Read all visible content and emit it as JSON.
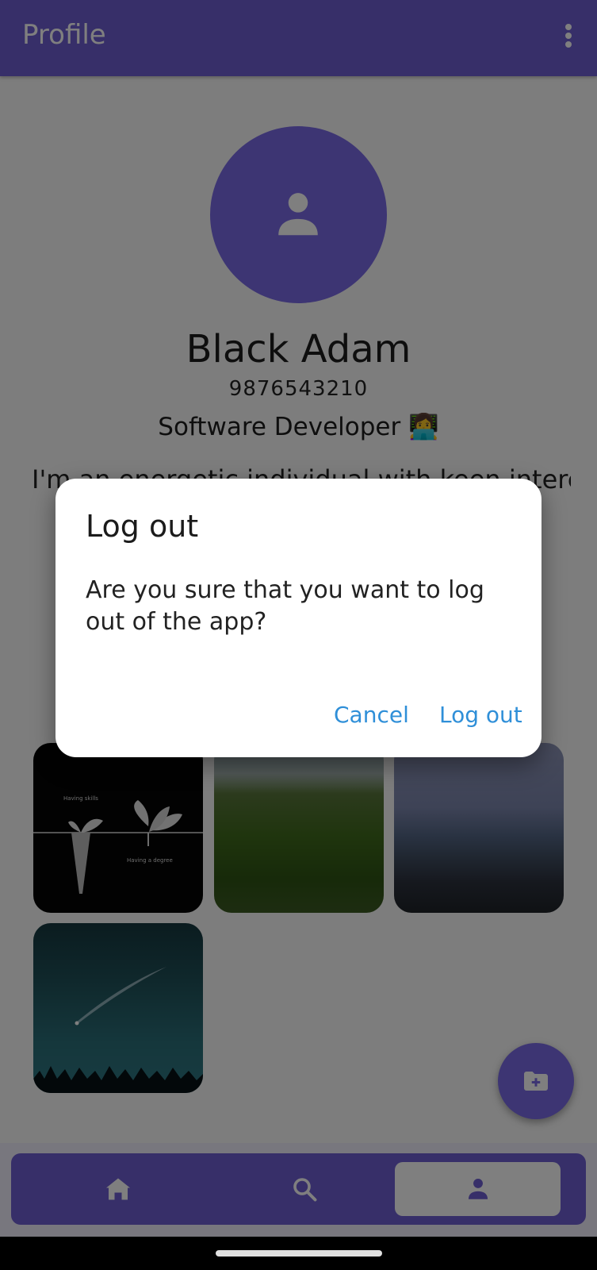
{
  "app_bar": {
    "title": "Profile"
  },
  "profile": {
    "name": "Black Adam",
    "phone": "9876543210",
    "role": "Software Developer 👩‍💻",
    "bio": "I'm an energetic individual with keen interest"
  },
  "gallery": {
    "tile1": {
      "label_top": "Having skills",
      "label_bottom": "Having a degree"
    }
  },
  "dialog": {
    "title": "Log out",
    "message": "Are you sure that you want to log out of the app?",
    "cancel_label": "Cancel",
    "confirm_label": "Log out"
  },
  "icons": {
    "menu": "more-vert-icon",
    "avatar": "person-icon",
    "fab": "folder-add-icon",
    "nav_home": "home-icon",
    "nav_search": "search-icon",
    "nav_profile": "person-icon"
  },
  "colors": {
    "primary": "#6f5fd3",
    "accent_button": "#2f8fd8",
    "scrim": "rgba(0,0,0,0.5)"
  }
}
